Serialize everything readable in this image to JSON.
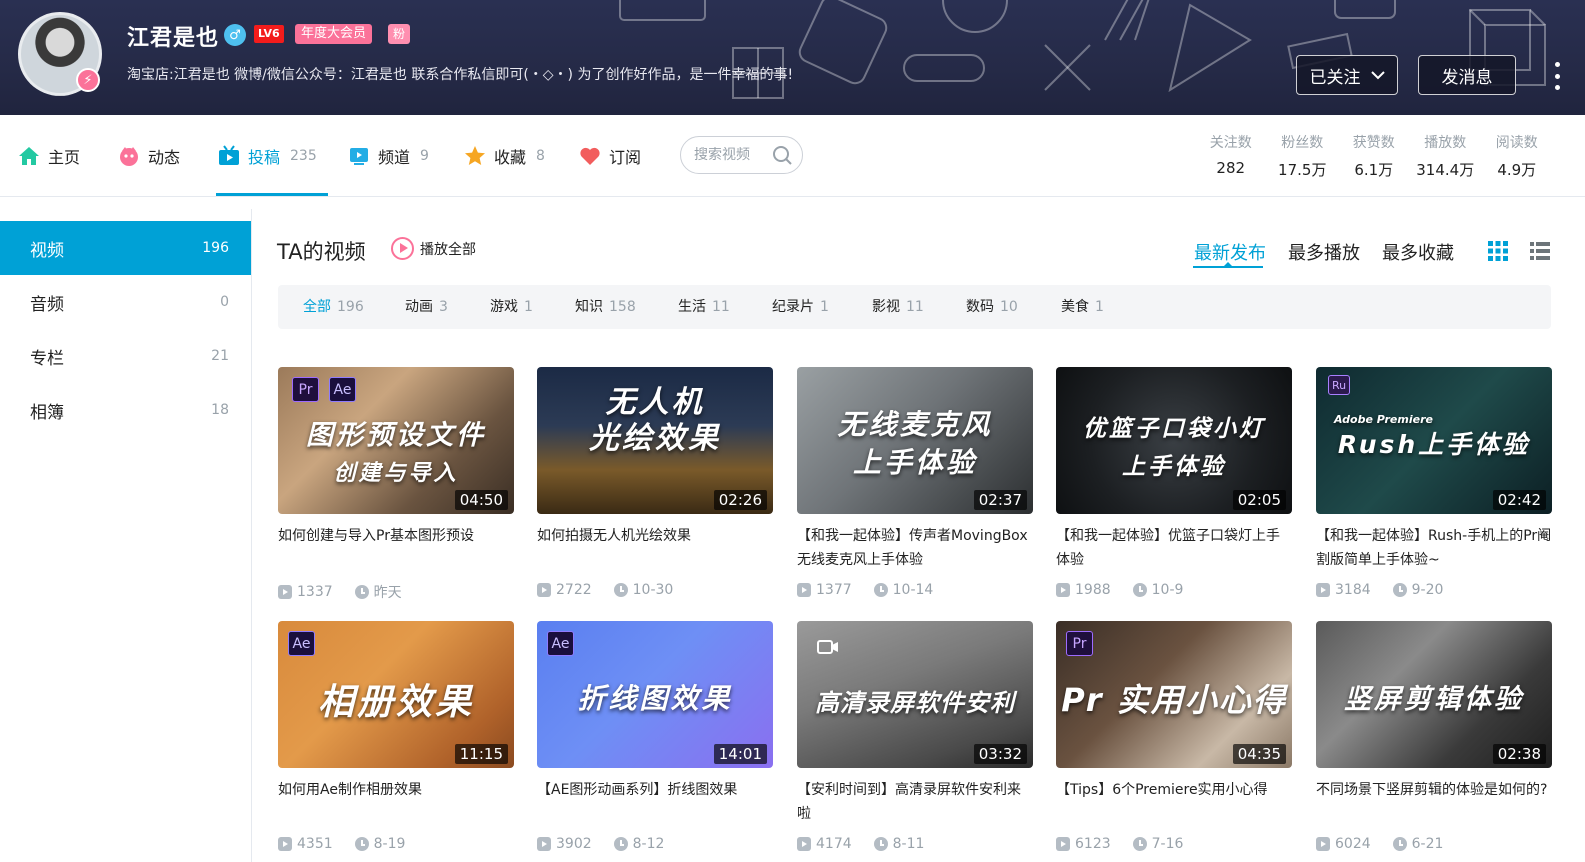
{
  "header": {
    "username": "江君是也",
    "gender_symbol": "♂",
    "level": "LV6",
    "vip": "年度大会员",
    "fan_tag": "粉",
    "signature": "淘宝店:江君是也 微博/微信公众号：江君是也 联系合作私信即可(・◇・) 为了创作好作品，是一件幸福的事!",
    "followed_label": "已关注",
    "message_label": "发消息"
  },
  "nav": {
    "items": [
      {
        "label": "主页",
        "count": "",
        "icon": "home-icon"
      },
      {
        "label": "动态",
        "count": "",
        "icon": "dynamic-icon"
      },
      {
        "label": "投稿",
        "count": "235",
        "icon": "upload-icon",
        "active": true
      },
      {
        "label": "频道",
        "count": "9",
        "icon": "channel-icon"
      },
      {
        "label": "收藏",
        "count": "8",
        "icon": "star-icon"
      },
      {
        "label": "订阅",
        "count": "",
        "icon": "heart-icon"
      }
    ],
    "search_placeholder": "搜索视频"
  },
  "stats": [
    {
      "label": "关注数",
      "value": "282"
    },
    {
      "label": "粉丝数",
      "value": "17.5万"
    },
    {
      "label": "获赞数",
      "value": "6.1万"
    },
    {
      "label": "播放数",
      "value": "314.4万"
    },
    {
      "label": "阅读数",
      "value": "4.9万"
    }
  ],
  "sidebar": {
    "items": [
      {
        "label": "视频",
        "count": "196",
        "active": true
      },
      {
        "label": "音频",
        "count": "0"
      },
      {
        "label": "专栏",
        "count": "21"
      },
      {
        "label": "相簿",
        "count": "18"
      }
    ]
  },
  "main": {
    "title": "TA的视频",
    "play_all": "播放全部",
    "sorts": [
      "最新发布",
      "最多播放",
      "最多收藏"
    ],
    "active_sort": "最新发布",
    "filters": [
      {
        "label": "全部",
        "count": "196",
        "active": true
      },
      {
        "label": "动画",
        "count": "3"
      },
      {
        "label": "游戏",
        "count": "1"
      },
      {
        "label": "知识",
        "count": "158"
      },
      {
        "label": "生活",
        "count": "11"
      },
      {
        "label": "纪录片",
        "count": "1"
      },
      {
        "label": "影视",
        "count": "11"
      },
      {
        "label": "数码",
        "count": "10"
      },
      {
        "label": "美食",
        "count": "1"
      }
    ]
  },
  "videos": [
    {
      "thumb_line1": "图形预设文件",
      "thumb_line2": "创建与导入",
      "duration": "04:50",
      "title": "如何创建与导入Pr基本图形预设",
      "plays": "1337",
      "date": "昨天",
      "badges": [
        "Pr",
        "Ae"
      ]
    },
    {
      "thumb_line1": "无人机",
      "thumb_line2": "光绘效果",
      "duration": "02:26",
      "title": "如何拍摄无人机光绘效果",
      "plays": "2722",
      "date": "10-30",
      "badges": []
    },
    {
      "thumb_line1": "无线麦克风",
      "thumb_line2": "上手体验",
      "duration": "02:37",
      "title": "【和我一起体验】传声者MovingBox无线麦克风上手体验",
      "plays": "1377",
      "date": "10-14",
      "badges": []
    },
    {
      "thumb_line1": "优篮子口袋小灯",
      "thumb_line2": "上手体验",
      "duration": "02:05",
      "title": "【和我一起体验】优篮子口袋灯上手体验",
      "plays": "1988",
      "date": "10-9",
      "badges": []
    },
    {
      "thumb_line1": "Rush上手体验",
      "thumb_line2": "Adobe Premiere",
      "duration": "02:42",
      "title": "【和我一起体验】Rush-手机上的Pr阉割版简单上手体验~",
      "plays": "3184",
      "date": "9-20",
      "badges": [
        "Ru"
      ]
    },
    {
      "thumb_line1": "相册效果",
      "thumb_line2": "",
      "duration": "11:15",
      "title": "如何用Ae制作相册效果",
      "plays": "4351",
      "date": "8-19",
      "badges": [
        "Ae"
      ]
    },
    {
      "thumb_line1": "折线图效果",
      "thumb_line2": "",
      "duration": "14:01",
      "title": "【AE图形动画系列】折线图效果",
      "plays": "3902",
      "date": "8-12",
      "badges": [
        "Ae"
      ]
    },
    {
      "thumb_line1": "高清录屏软件安利",
      "thumb_line2": "",
      "duration": "03:32",
      "title": "【安利时间到】高清录屏软件安利来啦",
      "plays": "4174",
      "date": "8-11",
      "badges": []
    },
    {
      "thumb_line1": "Pr 实用小心得",
      "thumb_line2": "",
      "duration": "04:35",
      "title": "【Tips】6个Premiere实用小心得",
      "plays": "6123",
      "date": "7-16",
      "badges": [
        "Pr"
      ]
    },
    {
      "thumb_line1": "竖屏剪辑体验",
      "thumb_line2": "",
      "duration": "02:38",
      "title": "不同场景下竖屏剪辑的体验是如何的?",
      "plays": "6024",
      "date": "6-21",
      "badges": []
    }
  ],
  "colors": {
    "accent": "#00a1d6",
    "pink": "#fb7299",
    "banner": "#252a47",
    "muted": "#99a2aa"
  }
}
